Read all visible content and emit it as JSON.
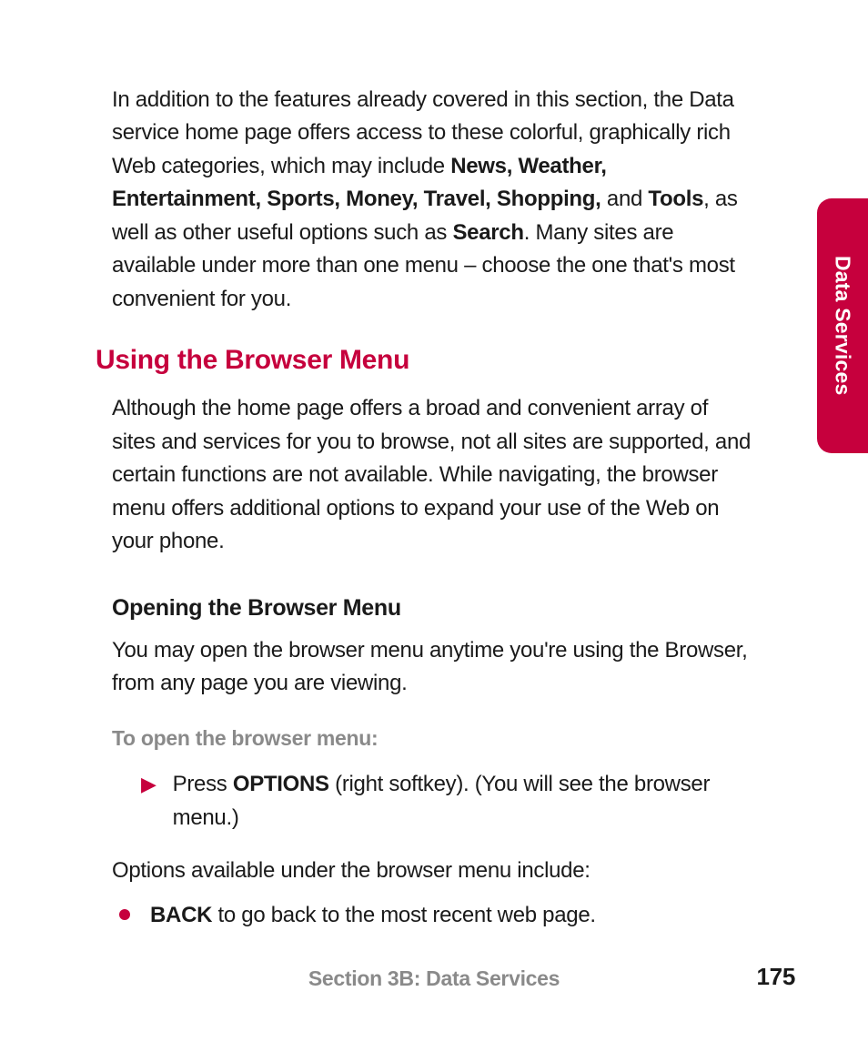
{
  "intro": {
    "pre": "In addition to the features already covered in this section, the Data service home page offers access to these colorful, graphically rich Web categories, which may include ",
    "bold1": "News, Weather, Entertainment, Sports, Money, Travel, Shopping,",
    "mid1": " and ",
    "bold2": "Tools",
    "mid2": ", as well as other useful options such as ",
    "bold3": "Search",
    "post": ". Many sites are available under more than one menu – choose the one that's most convenient for you."
  },
  "heading1": "Using the Browser Menu",
  "para2": "Although the home page offers a broad and convenient array of sites and services for you to browse, not all sites are supported, and certain functions are not available. While navigating, the browser menu offers additional options to expand your use of the Web on your phone.",
  "subheading": "Opening the Browser Menu",
  "para3": "You may open the browser menu anytime you're using the Browser, from any page you are viewing.",
  "smallheading": "To open the browser menu:",
  "step": {
    "pre": "Press ",
    "bold": "OPTIONS",
    "post": " (right softkey). (You will see the browser menu.)"
  },
  "optionsLine": "Options available under the browser menu include:",
  "bullet": {
    "bold": "BACK",
    "post": " to go back to the most recent web page."
  },
  "sideTab": "Data Services",
  "footerSection": "Section 3B: Data Services",
  "pageNumber": "175"
}
